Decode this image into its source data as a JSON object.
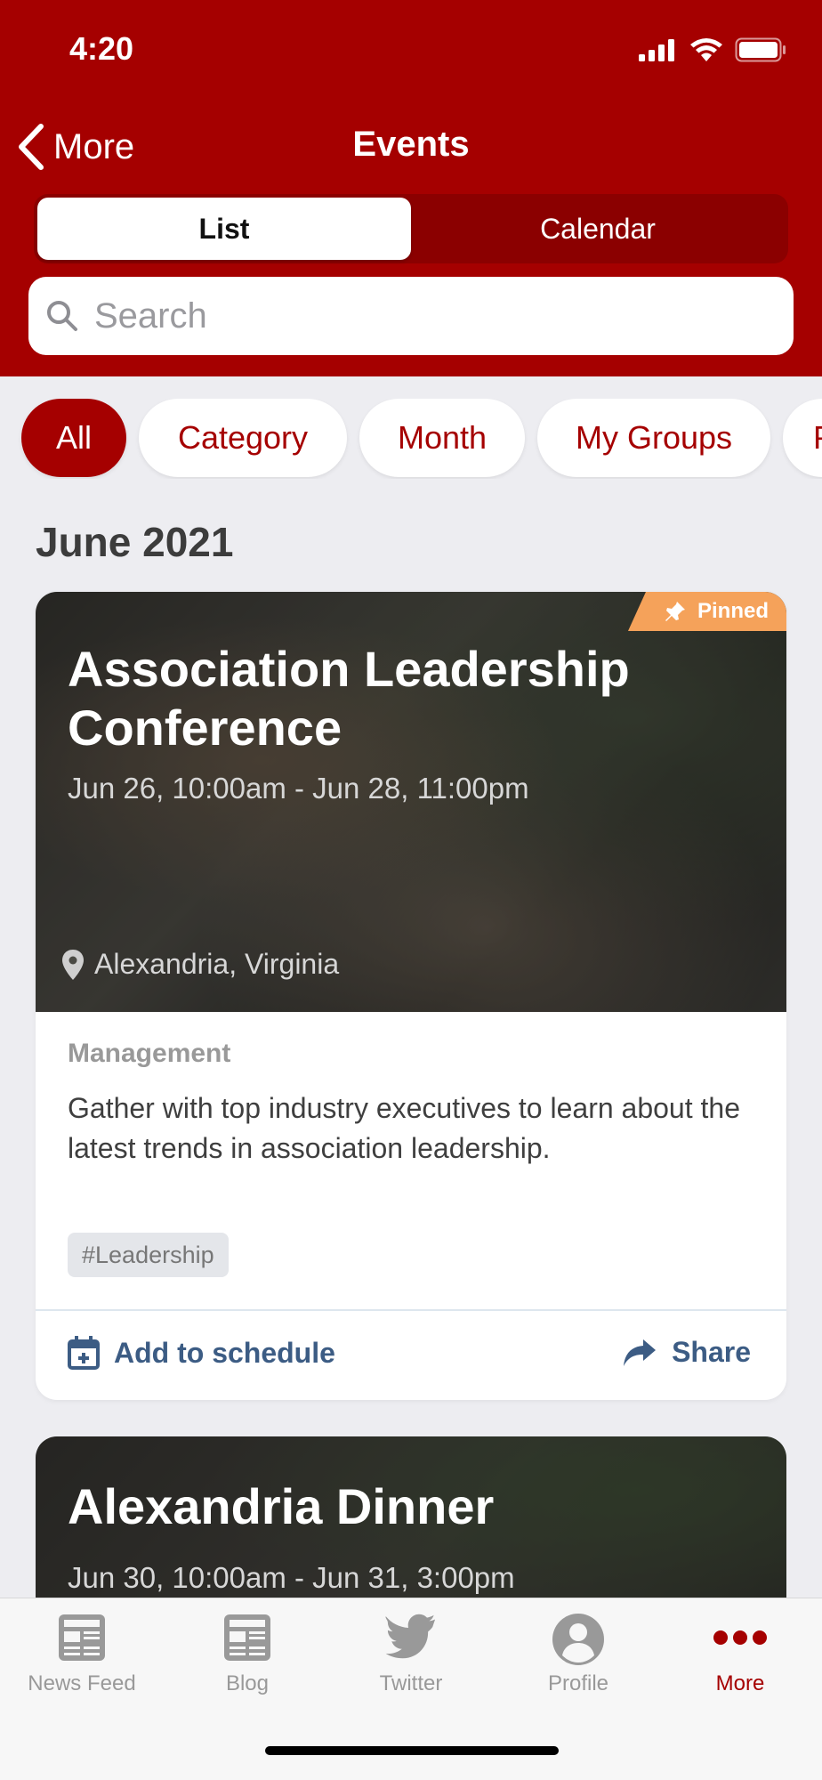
{
  "status_bar": {
    "time": "4:20"
  },
  "nav": {
    "back_label": "More",
    "title": "Events"
  },
  "segments": {
    "list": "List",
    "calendar": "Calendar"
  },
  "search": {
    "placeholder": "Search",
    "value": ""
  },
  "filters": [
    "All",
    "Category",
    "Month",
    "My Groups",
    "P"
  ],
  "section": {
    "title": "June 2021"
  },
  "events": [
    {
      "badge": "Pinned",
      "title": "Association Leadership Conference",
      "dates": "Jun 26, 10:00am - Jun 28, 11:00pm",
      "location": "Alexandria, Virginia",
      "category": "Management",
      "description": "Gather with top industry executives to learn about the latest trends in association leadership.",
      "tag": "#Leadership",
      "add_label": "Add to schedule",
      "share_label": "Share"
    },
    {
      "title": "Alexandria Dinner",
      "dates": "Jun 30, 10:00am - Jun 31, 3:00pm"
    }
  ],
  "tabbar": [
    {
      "label": "News Feed",
      "icon": "newspaper-icon"
    },
    {
      "label": "Blog",
      "icon": "newspaper-icon"
    },
    {
      "label": "Twitter",
      "icon": "twitter-bird-icon"
    },
    {
      "label": "Profile",
      "icon": "user-avatar-icon"
    },
    {
      "label": "More",
      "icon": "ellipsis-icon"
    }
  ],
  "colors": {
    "brand": "#a50000",
    "pinned": "#f5a25a",
    "action": "#3c5c84"
  }
}
